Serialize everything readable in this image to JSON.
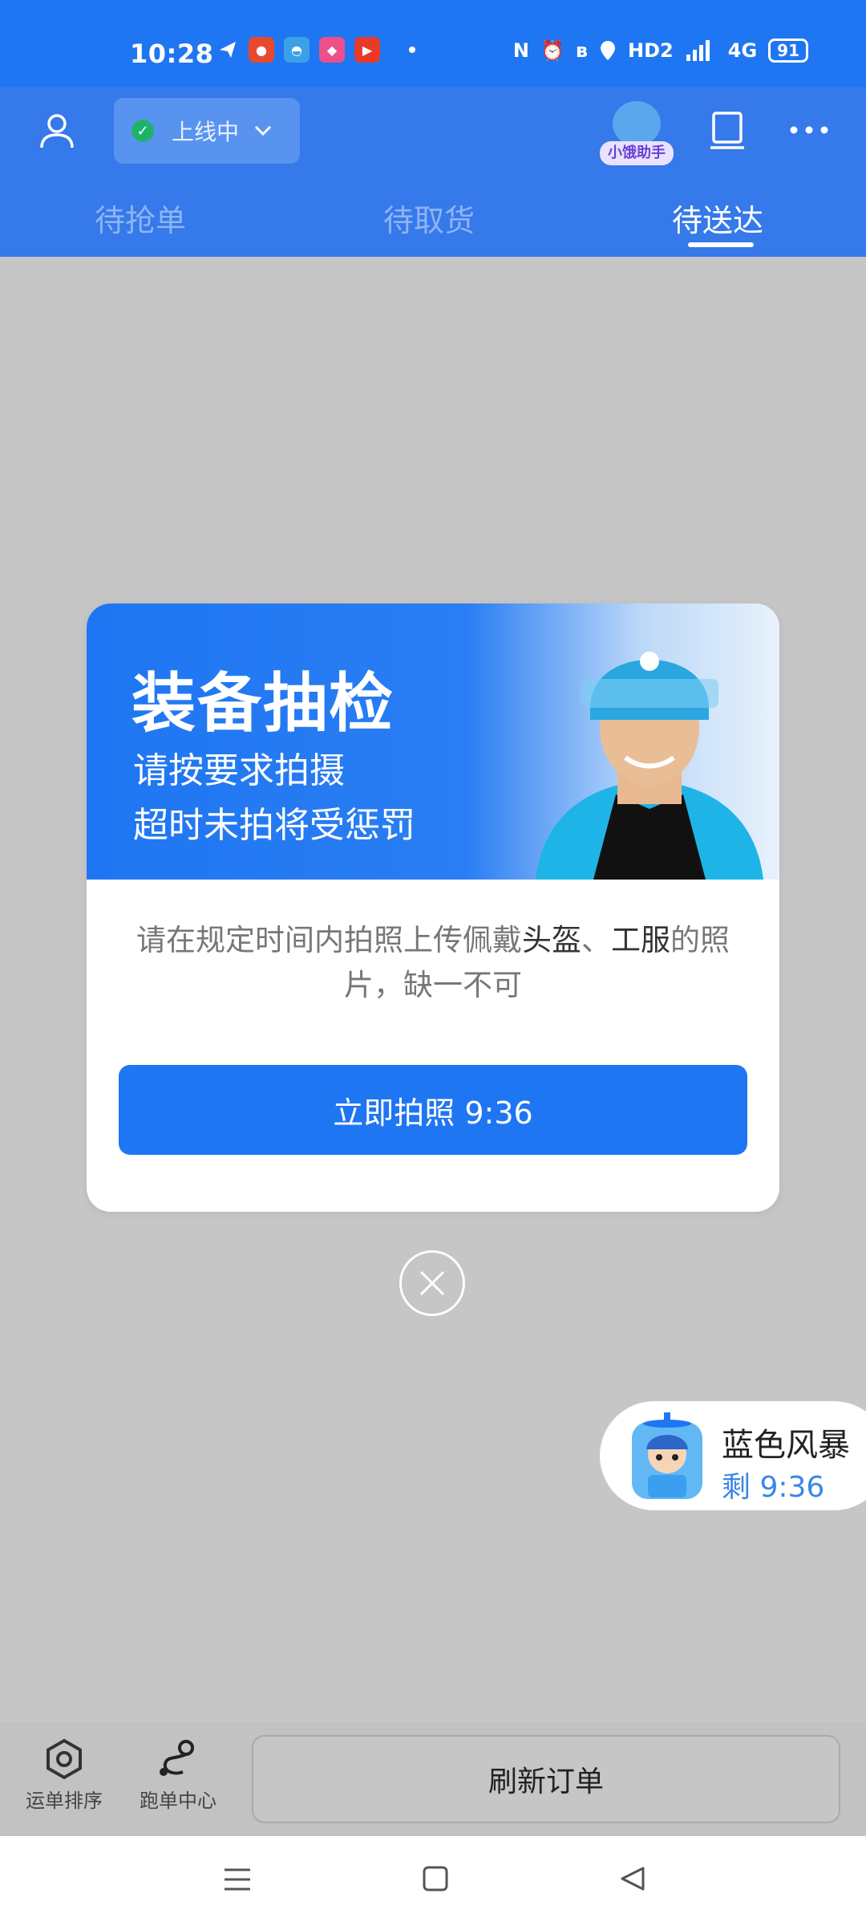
{
  "status_bar": {
    "time": "10:28",
    "battery": "91",
    "hd_label": "HD2",
    "network_label": "4G"
  },
  "header": {
    "online_status": "上线中",
    "assistant_label": "小饿助手",
    "tabs": [
      {
        "label": "待抢单",
        "active": false
      },
      {
        "label": "待取货",
        "active": false
      },
      {
        "label": "待送达",
        "active": true
      }
    ]
  },
  "modal": {
    "title": "装备抽检",
    "subtitle_line1": "请按要求拍摄",
    "subtitle_line2": "超时未拍将受惩罚",
    "message_pre": "请在规定时间内拍照上传佩戴",
    "message_helmet": "头盔",
    "message_sep": "、",
    "message_uniform": "工服",
    "message_post": "的照片，缺一不可",
    "primary_button": "立即拍照 9:36"
  },
  "floating_card": {
    "name": "蓝色风暴",
    "remaining": "剩 9:36"
  },
  "bottom_bar": {
    "sort_label": "运单排序",
    "run_center_label": "跑单中心",
    "refresh_label": "刷新订单"
  },
  "colors": {
    "primary_blue": "#1f76f2",
    "header_blue": "#3579ea",
    "overlay_gray": "#c6c6c6",
    "online_green": "#21b26a"
  }
}
